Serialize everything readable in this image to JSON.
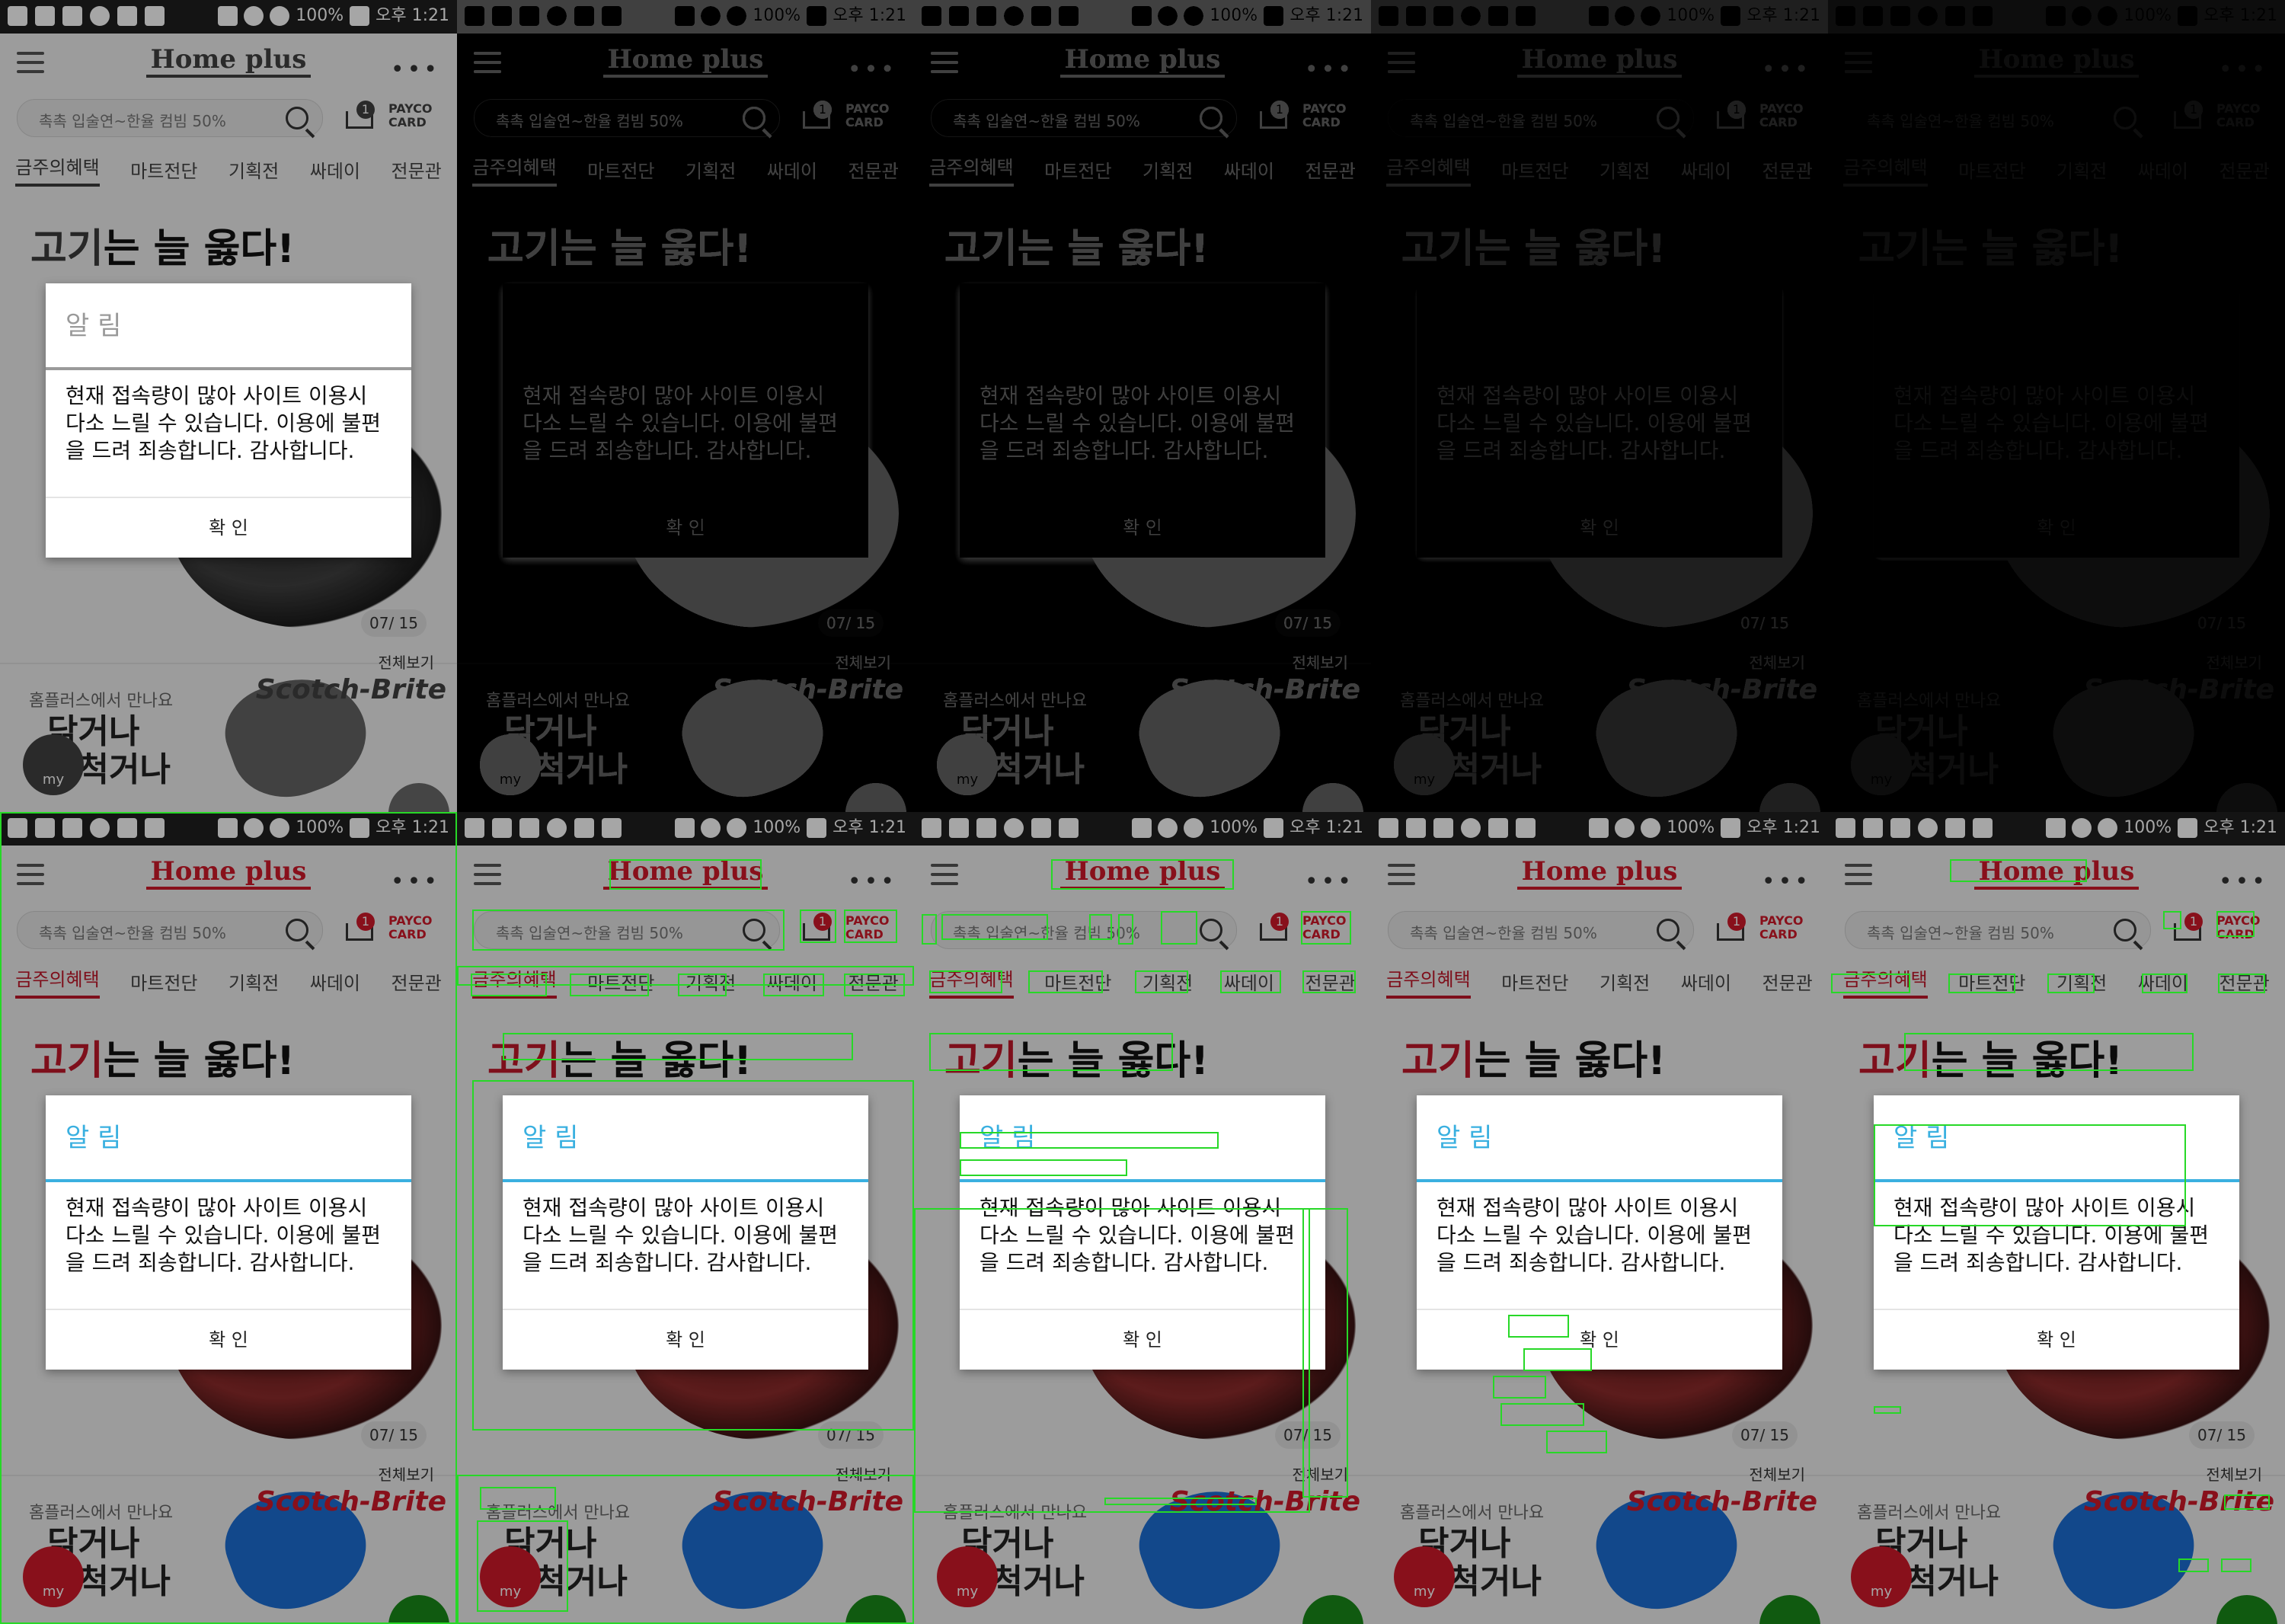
{
  "app": {
    "logo": "Home plus",
    "status_time": "오후 1:21",
    "status_battery": "100%",
    "search_placeholder": "촉촉 입술연~한율 컴빔 50%",
    "cart_badge": "1",
    "partner_card": "PAYCO CARD"
  },
  "tabs": [
    "금주의혜택",
    "마트전단",
    "기획전",
    "싸데이",
    "전문관"
  ],
  "hero": {
    "headline_part1": "고기",
    "headline_part2": "는 늘 옳다!",
    "pager": "07/ 15",
    "view_all": "전체보기"
  },
  "promo": {
    "small": "홈플러스에서 만나요",
    "big_line1": "닦거나",
    "big_line2": "세척거나",
    "brand": "Scotch-Brite",
    "my": "my"
  },
  "dialog": {
    "title": "알 림",
    "message": "현재 접속량이 많아 사이트 이용시 다소 느릴 수 있습니다. 이용에 불편을 드려 죄송합니다. 감사합니다.",
    "ok": "확 인"
  },
  "colors": {
    "brand_red": "#c2182a",
    "dialog_blue": "#3ab0e0",
    "overlay_green": "#27d827"
  }
}
